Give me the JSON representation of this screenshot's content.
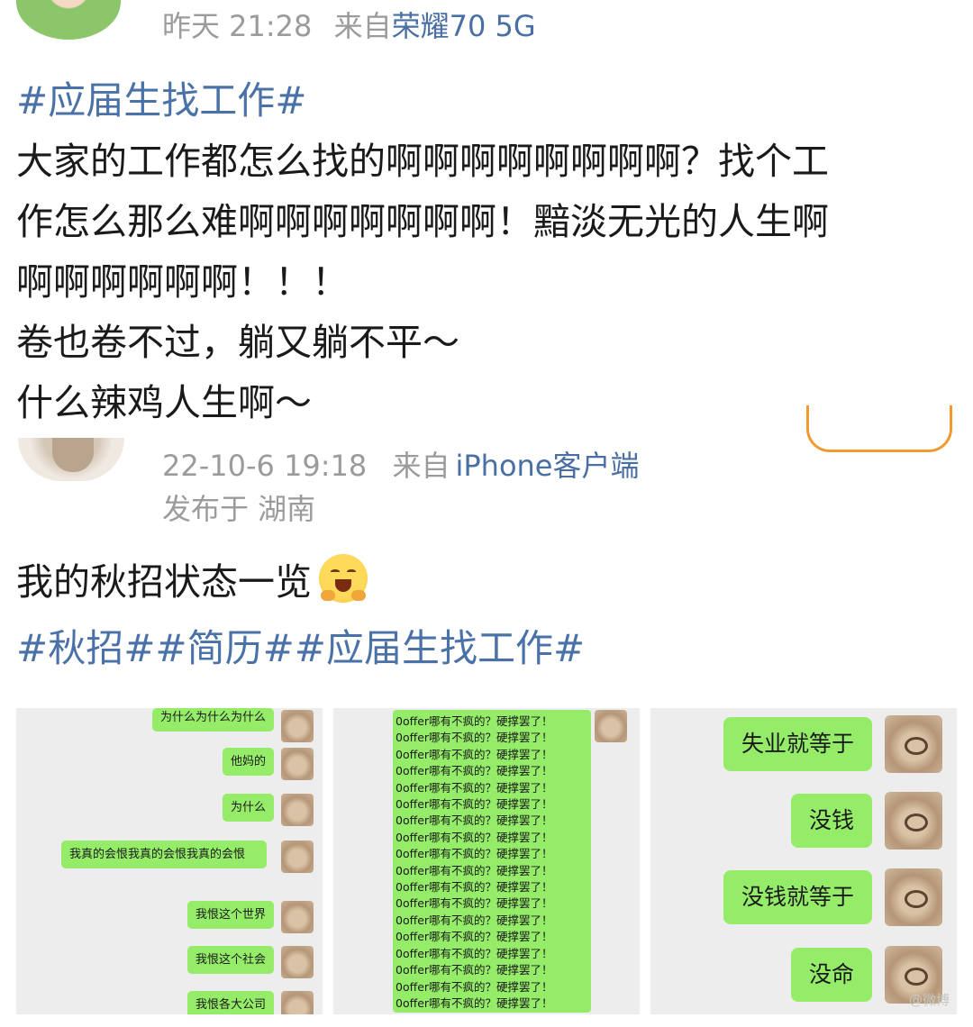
{
  "post1": {
    "time": "昨天 21:28",
    "source_prefix": "来自",
    "source": "荣耀70 5G",
    "hashtag": "#应届生找工作#",
    "lines": [
      "大家的工作都怎么找的啊啊啊啊啊啊啊啊？找个工",
      "作怎么那么难啊啊啊啊啊啊啊！黯淡无光的人生啊",
      "啊啊啊啊啊啊！！！",
      "卷也卷不过，躺又躺不平～",
      "什么辣鸡人生啊～"
    ]
  },
  "post2": {
    "time": "22-10-6 19:18",
    "source_prefix": "来自",
    "source": "iPhone客户端",
    "location": "发布于 湖南",
    "text": "我的秋招状态一览",
    "emoji": "blush-hands-emoji",
    "hashtags": "#秋招##简历##应届生找工作#",
    "images": {
      "chat1": [
        "为什么为什么为什么",
        "他妈的",
        "为什么",
        "我真的会恨我真的会恨我真的会恨",
        "我恨这个世界",
        "我恨这个社会",
        "我恨各大公司"
      ],
      "chat2_lines": [
        "0offer哪有不疯的？硬撑罢了！",
        "0offer哪有不疯的？硬撑罢了！",
        "0offer哪有不疯的？硬撑罢了！",
        "0offer哪有不疯的？硬撑罢了！",
        "0offer哪有不疯的？硬撑罢了！",
        "0offer哪有不疯的？硬撑罢了！",
        "0offer哪有不疯的？硬撑罢了！",
        "0offer哪有不疯的？硬撑罢了！",
        "0offer哪有不疯的？硬撑罢了！",
        "0offer哪有不疯的？硬撑罢了！",
        "0offer哪有不疯的？硬撑罢了！",
        "0offer哪有不疯的？硬撑罢了！",
        "0offer哪有不疯的？硬撑罢了！",
        "0offer哪有不疯的？硬撑罢了！",
        "0offer哪有不疯的？硬撑罢了！",
        "0offer哪有不疯的？硬撑罢了！",
        "0offer哪有不疯的？硬撑罢了！",
        "0offer哪有不疯的？硬撑罢了！"
      ],
      "chat3": [
        "失业就等于",
        "没钱",
        "没钱就等于",
        "没命"
      ],
      "watermark": "@微博"
    }
  },
  "colors": {
    "link": "#4b72a8",
    "meta_gray": "#9b9b9b",
    "bubble_green": "#95ec69",
    "follow_orange": "#f29a2e"
  }
}
